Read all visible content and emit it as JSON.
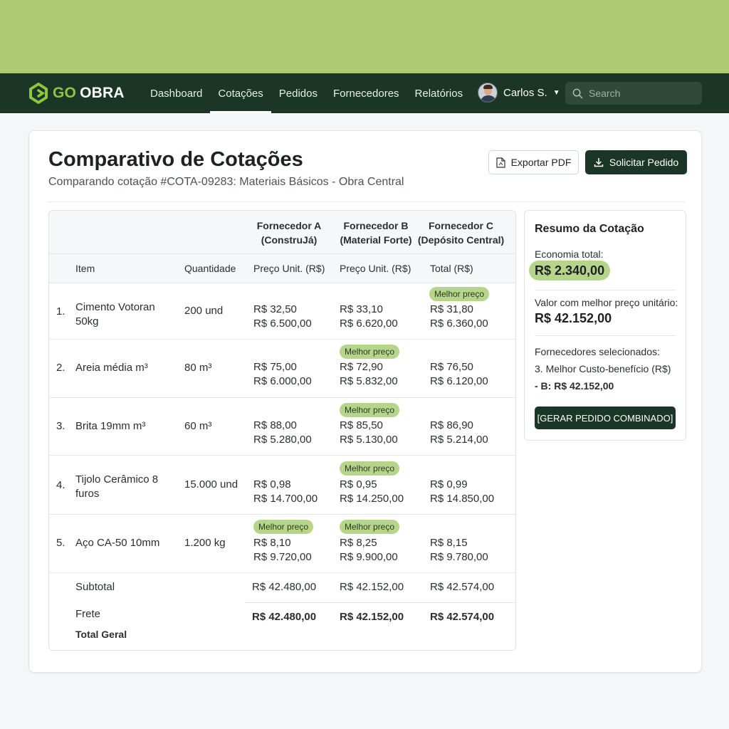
{
  "app": {
    "logo_go": "GO",
    "logo_obra": "OBRA"
  },
  "nav": {
    "links": [
      "Dashboard",
      "Cotações",
      "Pedidos",
      "Fornecedores",
      "Relatórios"
    ],
    "active_index": 1,
    "user_name": "Carlos S.",
    "search_placeholder": "Search"
  },
  "page": {
    "title": "Comparativo de Cotações",
    "subtitle": "Comparando cotação #COTA-09283: Materiais Básicos - Obra Central",
    "export_pdf_label": "Exportar PDF",
    "request_order_label": "Solicitar Pedido"
  },
  "table": {
    "suppliers": [
      {
        "line1": "Fornecedor A",
        "line2": "(ConstruJá)"
      },
      {
        "line1": "Fornecedor B",
        "line2": "(Material Forte)"
      },
      {
        "line1": "Fornecedor C",
        "line2": "(Depósito Central)"
      }
    ],
    "columns": [
      "Item",
      "Quantidade",
      "Preço Unit. (R$)",
      "Preço Unit. (R$)",
      "Total (R$)"
    ],
    "best_price_label": "Melhor preço",
    "rows": [
      {
        "num": "1.",
        "item_line1": "Cimento Votoran",
        "item_line2": "50kg",
        "qty": "200 und",
        "a_unit": "R$ 32,50",
        "a_total": "R$ 6.500,00",
        "b_unit": "R$ 33,10",
        "b_total": "R$ 6.620,00",
        "c_unit": "R$ 31,80",
        "c_total": "R$ 6.360,00"
      },
      {
        "num": "2.",
        "item_line1": "Areia média m³",
        "item_line2": "",
        "qty": "80 m³",
        "a_unit": "R$ 75,00",
        "a_total": "R$ 6.000,00",
        "b_unit": "R$ 72,90",
        "b_total": "R$ 5.832,00",
        "c_unit": "R$ 76,50",
        "c_total": "R$ 6.120,00"
      },
      {
        "num": "3.",
        "item_line1": "Brita 19mm m³",
        "item_line2": "",
        "qty": "60 m³",
        "a_unit": "R$ 88,00",
        "a_total": "R$ 5.280,00",
        "b_unit": "R$ 85,50",
        "b_total": "R$ 5.130,00",
        "c_unit": "R$ 86,90",
        "c_total": "R$ 5.214,00"
      },
      {
        "num": "4.",
        "item_line1": "Tijolo Cerâmico 8",
        "item_line2": "furos",
        "qty": "15.000 und",
        "a_unit": "R$ 0,98",
        "a_total": "R$ 14.700,00",
        "b_unit": "R$ 0,95",
        "b_total": "R$ 14.250,00",
        "c_unit": "R$ 0,99",
        "c_total": "R$ 14.850,00"
      },
      {
        "num": "5.",
        "item_line1": "Aço CA-50 10mm",
        "item_line2": "",
        "qty": "1.200 kg",
        "a_unit": "R$ 8,10",
        "a_total": "R$ 9.720,00",
        "b_unit": "R$ 8,25",
        "b_total": "R$ 9.900,00",
        "c_unit": "R$ 8,15",
        "c_total": "R$ 9.780,00"
      }
    ],
    "subtotal_label": "Subtotal",
    "subtotal": {
      "a": "R$ 42.480,00",
      "b": "R$ 42.152,00",
      "c": "R$ 42.574,00"
    },
    "frete_label": "Frete",
    "total_label": "Total Geral",
    "total": {
      "a": "R$ 42.480,00",
      "b": "R$ 42.152,00",
      "c": "R$ 42.574,00"
    }
  },
  "summary": {
    "title": "Resumo da Cotação",
    "economy_label": "Economia total:",
    "economy_value": "R$ 2.340,00",
    "best_value_label": "Valor com melhor preço unitário:",
    "best_value": "R$ 42.152,00",
    "selected_label": "Fornecedores selecionados:",
    "selected_line1": "3.  Melhor Custo-benefício (R$)",
    "selected_line2": "- B: R$ 42.152,00",
    "generate_button": "[GERAR PEDIDO COMBINADO]"
  },
  "colors": {
    "accent_green": "#b7d58a",
    "dark_green": "#1b3526",
    "top_band": "#aecb74"
  }
}
